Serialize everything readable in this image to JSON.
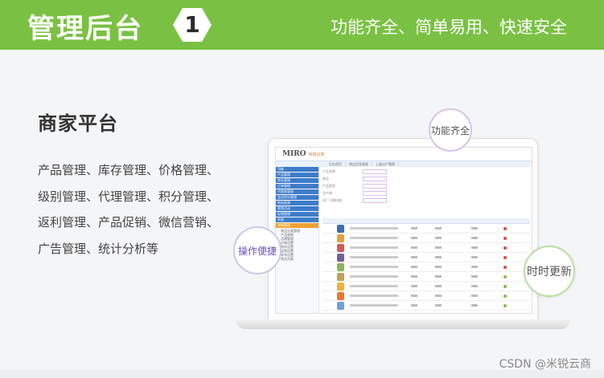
{
  "header": {
    "title": "管理后台",
    "step_number": "1",
    "slogan": "功能齐全、简单易用、快速安全"
  },
  "section": {
    "title": "商家平台",
    "features": [
      "产品管理、库存管理、价格管理、",
      "级别管理、代理管理、积分管理、",
      "返利管理、产品促销、微信营销、",
      "广告管理、统计分析等"
    ]
  },
  "screen": {
    "logo": "MIRO",
    "logo_sub": "米锐云商",
    "tabs": [
      "后台首页",
      "商品信息管理",
      "上架出产管理"
    ],
    "side_items": [
      "功能",
      "产品管理",
      "库存管理",
      "订单管理",
      "代理商管理",
      "会员积分管理",
      "财务报表",
      "营销活动",
      "促销管理",
      "系统",
      "商城管理"
    ],
    "side_subs": [
      "商品分类管理",
      "产品规格",
      "品牌管理",
      "价格设置",
      "库存设置",
      "促销设置",
      "发布设置",
      "商品列表"
    ],
    "form_labels": [
      "产品名称",
      "商品",
      "产品类型",
      "生产商",
      "出厂日期价格"
    ],
    "row_thumb_colors": [
      "#3a6fb0",
      "#e3a13b",
      "#d15b58",
      "#7a5b9a",
      "#8ab85c",
      "#c2a15a",
      "#f2b03a",
      "#e37b2d",
      "#6fa0d8"
    ],
    "row_dot_colors": [
      "#e04a3c",
      "#e04a3c",
      "#e04a3c",
      "#e04a3c",
      "#e04a3c",
      "#7ac143",
      "#7ac143",
      "#7ac143",
      "#7ac143"
    ]
  },
  "bubbles": {
    "functions": "功能齐全",
    "operation": "操作便捷",
    "realtime": "时时更新"
  },
  "watermark": "CSDN @米锐云商",
  "colors": {
    "brand_green": "#7ac143",
    "accent_orange": "#f0a030",
    "accent_blue": "#3d7cc9"
  }
}
